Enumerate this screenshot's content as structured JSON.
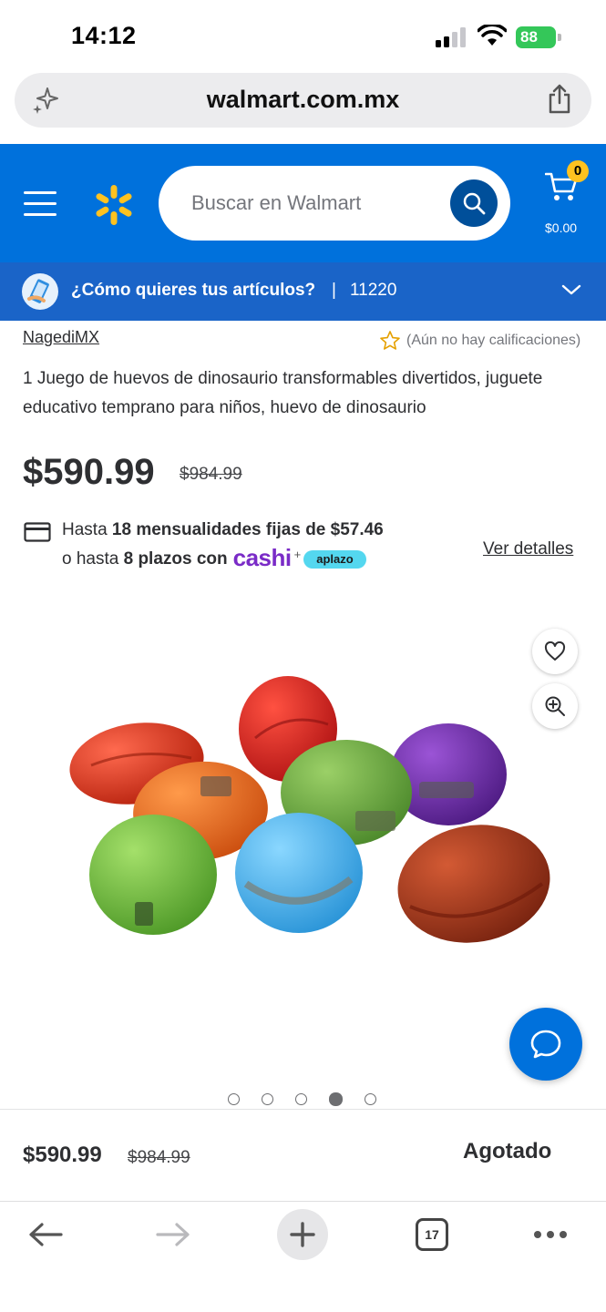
{
  "status_bar": {
    "time": "14:12",
    "battery": "88"
  },
  "browser": {
    "url": "walmart.com.mx",
    "tab_count": "17"
  },
  "header": {
    "search_placeholder": "Buscar en Walmart",
    "cart_count": "0",
    "cart_total": "$0.00",
    "brand_color": "#0071dc",
    "accent_color": "#ffc220"
  },
  "delivery": {
    "prompt": "¿Cómo quieres tus artículos?",
    "separator": "|",
    "zip": "11220"
  },
  "product": {
    "seller": "NagediMX",
    "rating_text": "(Aún no hay calificaciones)",
    "title": "1 Juego de huevos de dinosaurio transformables divertidos, juguete educativo temprano para niños, huevo de dinosaurio",
    "price": "$590.99",
    "was_price": "$984.99"
  },
  "installments": {
    "line1_prefix": "Hasta ",
    "line1_bold": "18 mensualidades fijas de $57.46",
    "line2_prefix": "o hasta ",
    "line2_bold": "8 plazos con",
    "cashi": "cashi",
    "plus": "+",
    "aplazo": "aplazo",
    "details_link": "Ver detalles"
  },
  "gallery": {
    "total_images": 5,
    "active_index": 3
  },
  "purchase_bar": {
    "price": "$590.99",
    "was_price": "$984.99",
    "status": "Agotado"
  }
}
